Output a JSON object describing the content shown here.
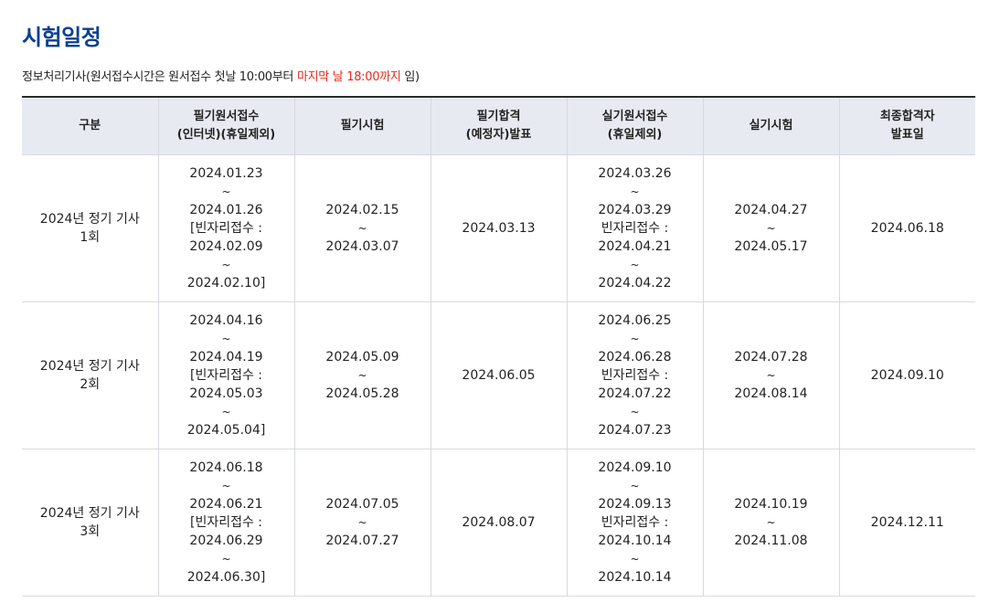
{
  "page": {
    "title": "시험일정",
    "notice_prefix": "정보처리기사(원서접수시간은 원서접수 첫날 10:00부터 ",
    "notice_highlight": "마지막 날 18:00까지",
    "notice_suffix": " 임)",
    "highlight_color": "#e8291c",
    "title_color": "#0b3f8f"
  },
  "table": {
    "headers": [
      [
        "구분"
      ],
      [
        "필기원서접수",
        "(인터넷)(휴일제외)"
      ],
      [
        "필기시험"
      ],
      [
        "필기합격",
        "(예정자)발표"
      ],
      [
        "실기원서접수",
        "(휴일제외)"
      ],
      [
        "실기시험"
      ],
      [
        "최종합격자",
        "발표일"
      ]
    ],
    "rows": [
      {
        "category": [
          "2024년 정기 기사",
          "1회"
        ],
        "written_apply": [
          "2024.01.23",
          "~",
          "2024.01.26",
          "[빈자리접수 :",
          "2024.02.09",
          "~",
          "2024.02.10]"
        ],
        "written_exam": [
          "2024.02.15",
          "~",
          "2024.03.07"
        ],
        "written_result": [
          "2024.03.13"
        ],
        "practical_apply": [
          "2024.03.26",
          "~",
          "2024.03.29",
          "빈자리접수 :",
          "2024.04.21",
          "~",
          "2024.04.22"
        ],
        "practical_exam": [
          "2024.04.27",
          "~",
          "2024.05.17"
        ],
        "final_result": [
          "2024.06.18"
        ]
      },
      {
        "category": [
          "2024년 정기 기사",
          "2회"
        ],
        "written_apply": [
          "2024.04.16",
          "~",
          "2024.04.19",
          "[빈자리접수 :",
          "2024.05.03",
          "~",
          "2024.05.04]"
        ],
        "written_exam": [
          "2024.05.09",
          "~",
          "2024.05.28"
        ],
        "written_result": [
          "2024.06.05"
        ],
        "practical_apply": [
          "2024.06.25",
          "~",
          "2024.06.28",
          "빈자리접수 :",
          "2024.07.22",
          "~",
          "2024.07.23"
        ],
        "practical_exam": [
          "2024.07.28",
          "~",
          "2024.08.14"
        ],
        "final_result": [
          "2024.09.10"
        ]
      },
      {
        "category": [
          "2024년 정기 기사",
          "3회"
        ],
        "written_apply": [
          "2024.06.18",
          "~",
          "2024.06.21",
          "[빈자리접수 :",
          "2024.06.29",
          "~",
          "2024.06.30]"
        ],
        "written_exam": [
          "2024.07.05",
          "~",
          "2024.07.27"
        ],
        "written_result": [
          "2024.08.07"
        ],
        "practical_apply": [
          "2024.09.10",
          "~",
          "2024.09.13",
          "빈자리접수 :",
          "2024.10.14",
          "~",
          "2024.10.14"
        ],
        "practical_exam": [
          "2024.10.19",
          "~",
          "2024.11.08"
        ],
        "final_result": [
          "2024.12.11"
        ]
      }
    ]
  }
}
